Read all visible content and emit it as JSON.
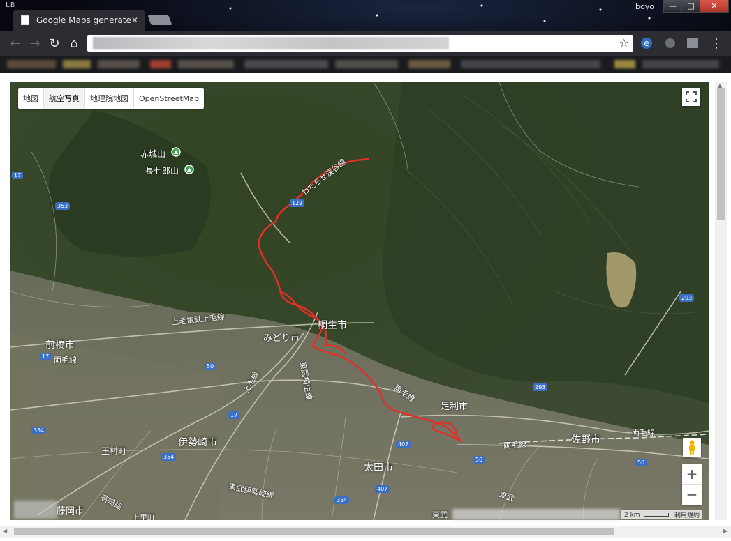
{
  "window": {
    "logo": "LB",
    "username": "boyo",
    "min": "—",
    "max": "□",
    "close": "✕"
  },
  "tab": {
    "title": "Google Maps generate",
    "close": "✕"
  },
  "nav": {
    "back": "←",
    "forward": "→",
    "reload": "↻",
    "home": "⌂"
  },
  "toolbar": {
    "star": "☆",
    "ext1": "e",
    "menu": "⋮"
  },
  "map": {
    "types": [
      "地図",
      "航空写真",
      "地理院地図",
      "OpenStreetMap"
    ],
    "active_type": "航空写真",
    "places": [
      {
        "name": "赤城山"
      },
      {
        "name": "長七郎山"
      },
      {
        "name": "前橋市"
      },
      {
        "name": "みどり市"
      },
      {
        "name": "桐生市"
      },
      {
        "name": "足利市"
      },
      {
        "name": "佐野市"
      },
      {
        "name": "伊勢崎市"
      },
      {
        "name": "太田市"
      },
      {
        "name": "玉村町"
      },
      {
        "name": "藤岡市"
      },
      {
        "name": "上毛電鉄上毛線"
      },
      {
        "name": "両毛線"
      },
      {
        "name": "東武桐生線"
      },
      {
        "name": "わたらせ渓谷線"
      },
      {
        "name": "東武伊勢崎線"
      },
      {
        "name": "高崎線"
      },
      {
        "name": "上毛線"
      },
      {
        "name": "東武"
      },
      {
        "name": "上里町"
      },
      {
        "name": "東武"
      }
    ],
    "road_shields": [
      "17",
      "353",
      "122",
      "50",
      "17",
      "354",
      "354",
      "407",
      "50",
      "293",
      "293",
      "50",
      "407",
      "354",
      "17"
    ],
    "route_color": "#e0302a",
    "scale": "2 km",
    "terms": "利用規約",
    "zoom_in": "+",
    "zoom_out": "−"
  }
}
